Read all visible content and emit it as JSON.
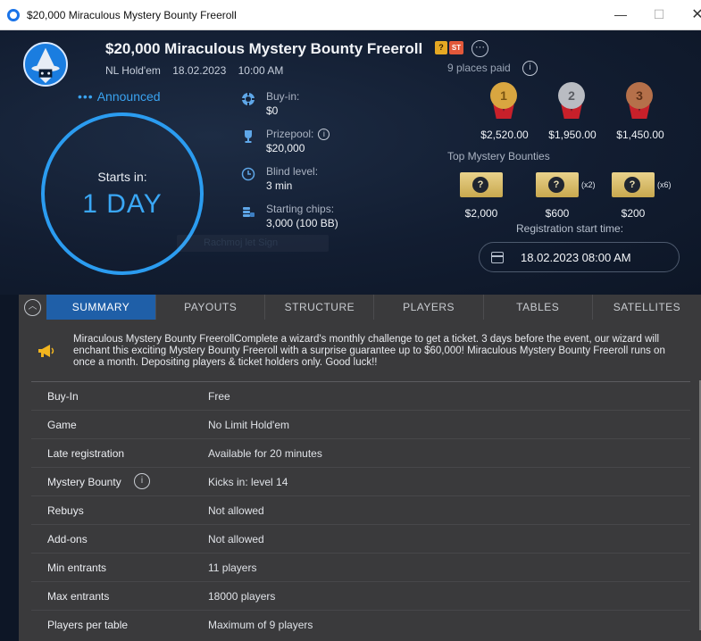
{
  "window": {
    "title": "$20,000 Miraculous Mystery Bounty Freeroll",
    "min": "—",
    "max": "☐",
    "close": "✕"
  },
  "tournament": {
    "title": "$20,000 Miraculous Mystery Bounty Freeroll",
    "badge_q": "?",
    "badge_st": "ST",
    "more": "···",
    "game": "NL Hold'em",
    "date": "18.02.2023",
    "time": "10:00 AM",
    "status": "Announced",
    "status_dots": "•••",
    "starts_label": "Starts in:",
    "starts_value": "1 DAY"
  },
  "info": [
    {
      "key": "Buy-in:",
      "value": "$0",
      "icon": "chip-icon"
    },
    {
      "key": "Prizepool:",
      "value": "$20,000",
      "icon": "trophy-icon"
    },
    {
      "key": "Blind level:",
      "value": "3 min",
      "icon": "clock-icon"
    },
    {
      "key": "Starting chips:",
      "value": "3,000 (100 BB)",
      "icon": "chips-stack-icon"
    }
  ],
  "ghost_button": "Rachmoj let Sign",
  "places_paid": "9 places paid",
  "prizes": [
    {
      "rank": "1",
      "amount": "$2,520.00",
      "color": "#d9a640"
    },
    {
      "rank": "2",
      "amount": "$1,950.00",
      "color": "#b9bcc2"
    },
    {
      "rank": "3",
      "amount": "$1,450.00",
      "color": "#b5704a"
    }
  ],
  "bounties_label": "Top Mystery Bounties",
  "bounties": [
    {
      "amount": "$2,000",
      "mult": ""
    },
    {
      "amount": "$600",
      "mult": "(x2)"
    },
    {
      "amount": "$200",
      "mult": "(x6)"
    }
  ],
  "registration": {
    "label": "Registration start time:",
    "value": "18.02.2023 08:00 AM"
  },
  "tabs": [
    "SUMMARY",
    "PAYOUTS",
    "STRUCTURE",
    "PLAYERS",
    "TABLES",
    "SATELLITES"
  ],
  "notice": "Miraculous Mystery Bounty FreerollComplete a wizard's monthly challenge to get a ticket. 3 days before the event, our wizard will enchant this exciting Mystery Bounty Freeroll with a surprise guarantee up to $60,000! Miraculous Mystery Bounty Freeroll runs on once a month. Depositing players & ticket holders only. Good luck!!",
  "summary": [
    {
      "label": "Buy-In",
      "value": "Free"
    },
    {
      "label": "Game",
      "value": "No Limit Hold'em"
    },
    {
      "label": "Late registration",
      "value": "Available for 20 minutes"
    },
    {
      "label": "Mystery Bounty",
      "value": "Kicks in: level 14"
    },
    {
      "label": "Rebuys",
      "value": "Not allowed"
    },
    {
      "label": "Add-ons",
      "value": "Not allowed"
    },
    {
      "label": "Min entrants",
      "value": "11 players"
    },
    {
      "label": "Max entrants",
      "value": "18000 players"
    },
    {
      "label": "Players per table",
      "value": "Maximum of 9 players"
    }
  ],
  "colors": {
    "accent": "#2b9cf0",
    "active_tab": "#1f5fa8",
    "panel": "#3a3a3c"
  }
}
